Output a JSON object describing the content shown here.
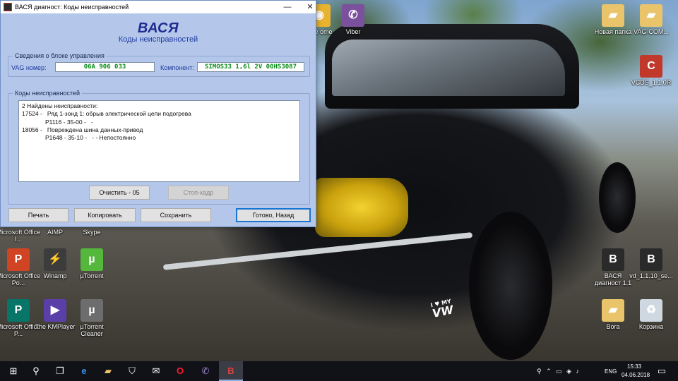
{
  "window": {
    "title": "ВАСЯ диагност: Коды неисправностей",
    "close_glyph": "✕",
    "minimize_glyph": "—",
    "app_logo": "ВАСЯ",
    "app_subtitle": "Коды неисправностей"
  },
  "ecu_info": {
    "group_label": "Сведения о блоке управления",
    "vag_label": "VAG номер:",
    "vag_value": "06A 906 033",
    "component_label": "Компонент:",
    "component_value": "SIMOS33 1,6l 2V 00HS3087"
  },
  "fault_codes": {
    "group_label": "Коды неисправностей",
    "lines": [
      {
        "text": "2 Найдены неисправности:",
        "indent": false
      },
      {
        "text": "17524 -   Ряд 1-зонд 1: обрыв электрической цепи подогрева",
        "indent": false
      },
      {
        "text": "P1116 - 35-00 -   -",
        "indent": true
      },
      {
        "text": "18056 -   Повреждена шина данных-привод",
        "indent": false
      },
      {
        "text": "P1648 - 35-10 -   - - Непостоянно",
        "indent": true
      }
    ]
  },
  "buttons": {
    "clear": "Очистить - 05",
    "freeze_frame": "Стоп-кадр",
    "print": "Печать",
    "copy": "Копировать",
    "save": "Сохранить",
    "done": "Готово, Назад"
  },
  "desktop_icons": [
    {
      "name": "viber",
      "label": "Viber",
      "glyph": "✆",
      "color": "#7b519d"
    },
    {
      "name": "chrome",
      "label": "ogle ome",
      "glyph": "◉",
      "color": "#e8b32e"
    },
    {
      "name": "new-folder",
      "label": "Новая папка",
      "glyph": "▰",
      "color": "#e9c46a"
    },
    {
      "name": "vag-com-folder",
      "label": "VAG-COM...",
      "glyph": "▰",
      "color": "#e9c46a"
    },
    {
      "name": "vcds",
      "label": "VCDS_1.1.0R",
      "glyph": "C",
      "color": "#c0392b"
    },
    {
      "name": "office-1",
      "label": "Microsoft Office I...",
      "glyph": "▦",
      "color": "#d04423"
    },
    {
      "name": "aimp",
      "label": "AIMP",
      "glyph": "♫",
      "color": "#f0a030"
    },
    {
      "name": "skype",
      "label": "Skype",
      "glyph": "S",
      "color": "#00aff0"
    },
    {
      "name": "office-powerpoint",
      "label": "Microsoft Office Po...",
      "glyph": "P",
      "color": "#d04423"
    },
    {
      "name": "winamp",
      "label": "Winamp",
      "glyph": "⚡",
      "color": "#3c3c3c"
    },
    {
      "name": "utorrent",
      "label": "µTorrent",
      "glyph": "µ",
      "color": "#55b83c"
    },
    {
      "name": "office-publisher",
      "label": "Microsoft Office P...",
      "glyph": "P",
      "color": "#077568"
    },
    {
      "name": "kmplayer",
      "label": "The KMPlayer",
      "glyph": "▶",
      "color": "#5b3fa8"
    },
    {
      "name": "utorrent-cleaner",
      "label": "µTorrent Cleaner",
      "glyph": "µ",
      "color": "#6d6d6d"
    },
    {
      "name": "vasya-1",
      "label": "ВАСЯ диагност 1.1",
      "glyph": "В",
      "color": "#2a2a2a"
    },
    {
      "name": "vasya-2",
      "label": "vd_1.1.10_se...",
      "glyph": "В",
      "color": "#2a2a2a"
    },
    {
      "name": "bora",
      "label": "Bora",
      "glyph": "▰",
      "color": "#e9c46a"
    },
    {
      "name": "recycle-bin",
      "label": "Корзина",
      "glyph": "♻",
      "color": "#cfd8e0"
    }
  ],
  "sticker": {
    "line1": "I ♥ MY",
    "line2": "VW"
  },
  "taskbar": {
    "start_glyph": "⊞",
    "search_glyph": "⚲",
    "taskview_glyph": "❐",
    "edge_glyph": "e",
    "explorer_glyph": "▰",
    "store_glyph": "⛉",
    "mail_glyph": "✉",
    "opera_glyph": "O",
    "viber_glyph": "✆",
    "vasya_glyph": "В",
    "tray_glyphs": "⚲  ⌃  ▭  ◈  ♪",
    "language": "ENG",
    "time": "15:33",
    "date": "04.06.2018",
    "notification_glyph": "▭"
  }
}
